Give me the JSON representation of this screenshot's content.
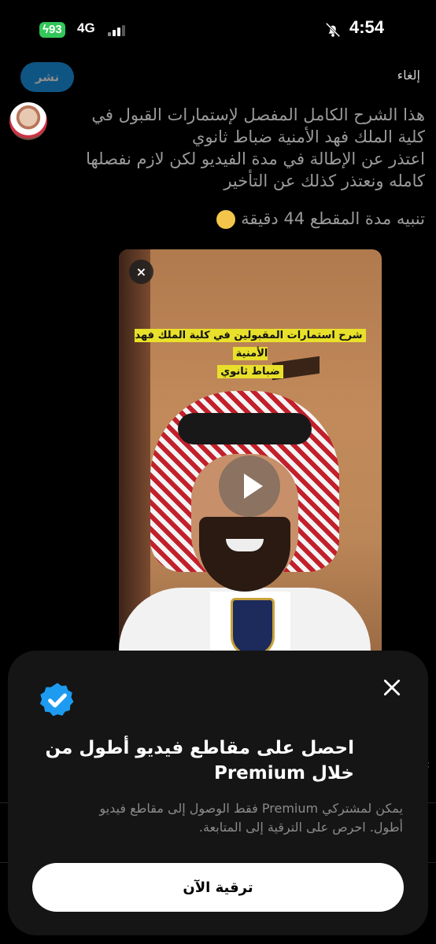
{
  "status_bar": {
    "battery": "93",
    "network": "4G",
    "time": "4:54"
  },
  "header": {
    "post_label": "نشر",
    "cancel_label": "إلغاء"
  },
  "tweet": {
    "lines": [
      "هذا الشرح الكامل المفصل لإستمارات القبول في",
      "كلية الملك فهد الأمنية ضباط ثانوي",
      "اعتذر عن الإطالة في مدة الفيديو لكن لازم نفصلها",
      "كامله ونعتذر كذلك عن التأخير"
    ],
    "note": "تنبيه مدة المقطع 44 دقيقة"
  },
  "video": {
    "caption_line1": "شرح استمارات المقبولين في كلية الملك فهد الأمنية",
    "caption_line2": "ضباط ثانوي",
    "close_symbol": "×"
  },
  "premium_sheet": {
    "title_line1": "احصل على مقاطع فيديو أطول من",
    "title_line2": "خلال Premium",
    "desc_line1": "يمكن لمشتركي Premium فقط الوصول إلى مقاطع فيديو",
    "desc_line2": "أطول. احرص على الترقية إلى المتابعة.",
    "upgrade_label": "ترقية الآن",
    "accent": "#1d9bf0"
  }
}
